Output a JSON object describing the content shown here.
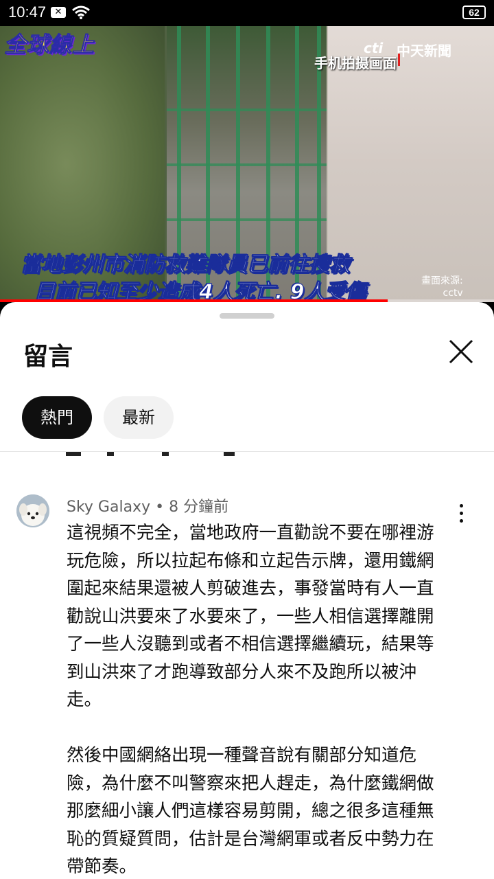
{
  "status_bar": {
    "time": "10:47",
    "battery": "62"
  },
  "video": {
    "channel_logo": "全球線上",
    "network_logo": "中天新聞",
    "network_logo_small": "cti",
    "phone_label": "手机拍摄画面",
    "subtitle_line1": "當地彭州市消防救難隊員已前往搜救",
    "subtitle_line2": "目前已知至少造成4人死亡. 9人受傷",
    "source_label": "畫面來源:",
    "source_name": "cctv",
    "progress_percent": 78.5
  },
  "comments_panel": {
    "title": "留言",
    "tabs": [
      {
        "label": "熱門",
        "selected": true
      },
      {
        "label": "最新",
        "selected": false
      }
    ],
    "comment": {
      "author": "Sky Galaxy",
      "time": "8 分鐘前",
      "paragraph1": "這視頻不完全，當地政府一直勸說不要在哪裡游玩危險，所以拉起布條和立起告示牌，還用鐵網圍起來結果還被人剪破進去，事發當時有人一直勸說山洪要來了水要來了，一些人相信選擇離開了一些人沒聽到或者不相信選擇繼續玩，結果等到山洪來了才跑導致部分人來不及跑所以被沖走。",
      "paragraph2": "然後中國網絡出現一種聲音說有關部分知道危險，為什麼不叫警察來把人趕走，為什麼鐵網做那麼細小讓人們這樣容易剪開，總之很多這種無恥的質疑質問，估計是台灣網軍或者反中勢力在帶節奏。"
    }
  },
  "colors": {
    "accent": "#ff0000",
    "chip_selected": "#0f0f0f",
    "chip_unselected": "#f2f2f2"
  }
}
